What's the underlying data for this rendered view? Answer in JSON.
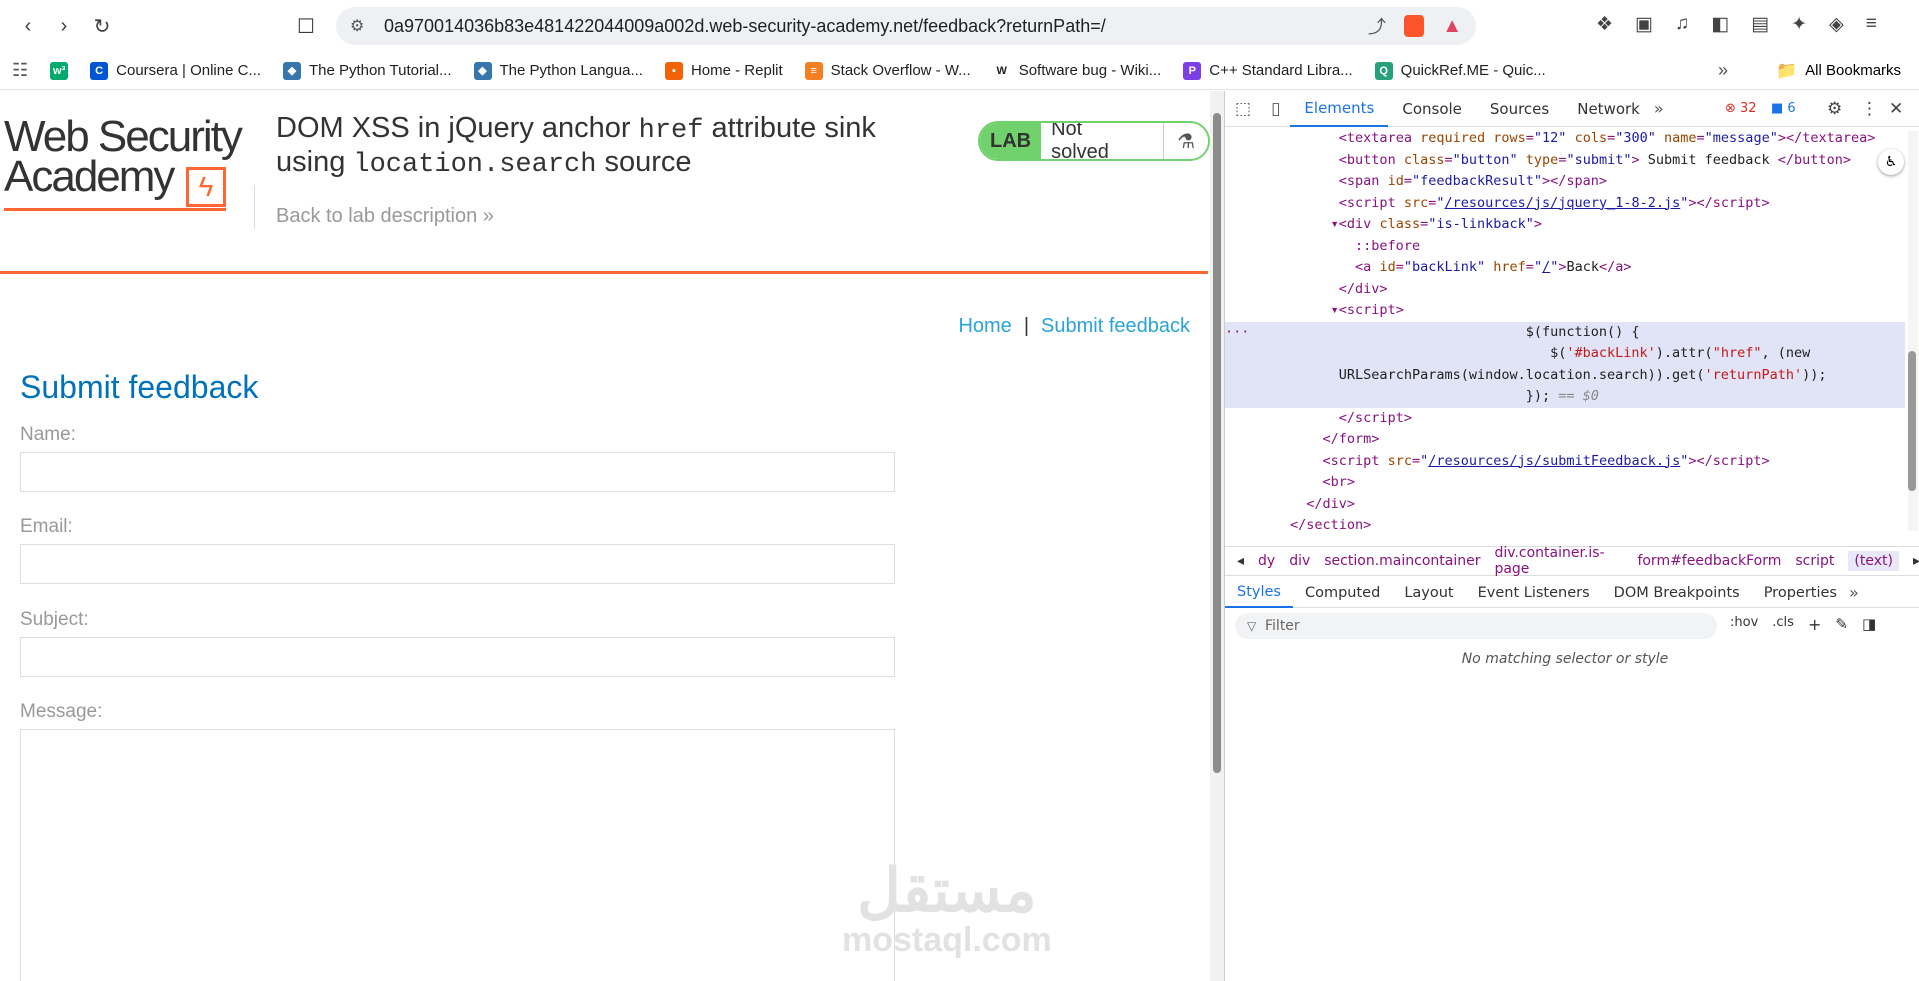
{
  "browser": {
    "url": "0a970014036b83e481422044009a002d.web-security-academy.net/feedback?returnPath=/",
    "bookmarks": [
      {
        "label": "",
        "icon": "w3-icon",
        "color": "#04aa6d",
        "glyph": "w³"
      },
      {
        "label": "Coursera | Online C...",
        "icon": "coursera-icon",
        "color": "#0056d2",
        "glyph": "C"
      },
      {
        "label": "The Python Tutorial...",
        "icon": "python-icon",
        "color": "#3776ab",
        "glyph": "◆"
      },
      {
        "label": "The Python Langua...",
        "icon": "python-icon",
        "color": "#3776ab",
        "glyph": "◆"
      },
      {
        "label": "Home - Replit",
        "icon": "replit-icon",
        "color": "#f26207",
        "glyph": "▪"
      },
      {
        "label": "Stack Overflow - W...",
        "icon": "stackoverflow-icon",
        "color": "#f48024",
        "glyph": "≡"
      },
      {
        "label": "Software bug - Wiki...",
        "icon": "wikipedia-icon",
        "color": "#ffffff",
        "glyph": "W"
      },
      {
        "label": "C++ Standard Libra...",
        "icon": "cpp-icon",
        "color": "#7b3fe4",
        "glyph": "P"
      },
      {
        "label": "QuickRef.ME - Quic...",
        "icon": "quickref-icon",
        "color": "#27a17a",
        "glyph": "Q"
      }
    ],
    "all_bookmarks": "All Bookmarks"
  },
  "page": {
    "logo_line1": "Web Security",
    "logo_line2": "Academy",
    "title_part1": "DOM XSS in jQuery anchor ",
    "title_code1": "href",
    "title_part2": " attribute sink using ",
    "title_code2": "location.search",
    "title_part3": " source",
    "back_link": "Back to lab description",
    "badge_lab": "LAB",
    "badge_status": "Not solved",
    "nav_home": "Home",
    "nav_sep": "|",
    "nav_feedback": "Submit feedback",
    "heading": "Submit feedback",
    "labels": {
      "name": "Name:",
      "email": "Email:",
      "subject": "Subject:",
      "message": "Message:"
    },
    "watermark_ar": "مستقل",
    "watermark_en": "mostaql.com"
  },
  "devtools": {
    "tabs": [
      "Elements",
      "Console",
      "Sources",
      "Network"
    ],
    "errors": "32",
    "messages": "6",
    "crumbs": [
      "dy",
      "div",
      "section.maincontainer",
      "div.container.is-page",
      "form#feedbackForm",
      "script",
      "(text)"
    ],
    "style_tabs": [
      "Styles",
      "Computed",
      "Layout",
      "Event Listeners",
      "DOM Breakpoints",
      "Properties"
    ],
    "filter_placeholder": "Filter",
    "hov": ":hov",
    "cls": ".cls",
    "no_match": "No matching selector or style"
  }
}
